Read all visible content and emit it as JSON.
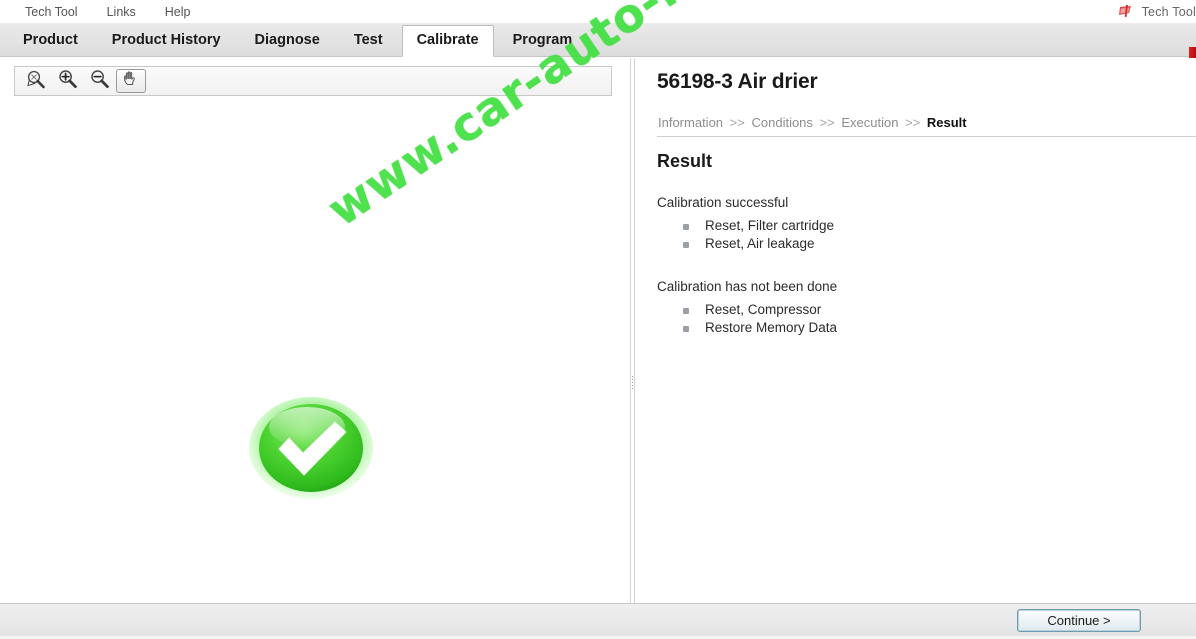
{
  "app": {
    "brand_name": "Tech Tool",
    "brand_logo_icon": "volvo-flag-logo-icon"
  },
  "menubar": {
    "items": [
      {
        "label": "Tech Tool",
        "name": "menu-tech-tool"
      },
      {
        "label": "Links",
        "name": "menu-links"
      },
      {
        "label": "Help",
        "name": "menu-help"
      }
    ]
  },
  "tabs": [
    {
      "label": "Product",
      "active": false
    },
    {
      "label": "Product History",
      "active": false
    },
    {
      "label": "Diagnose",
      "active": false
    },
    {
      "label": "Test",
      "active": false
    },
    {
      "label": "Calibrate",
      "active": true
    },
    {
      "label": "Program",
      "active": false
    }
  ],
  "viewer": {
    "toolbar": [
      {
        "icon": "zoom-to-fit-icon",
        "name": "zoom-to-fit-button",
        "selected": false
      },
      {
        "icon": "zoom-in-icon",
        "name": "zoom-in-button",
        "selected": false
      },
      {
        "icon": "zoom-out-icon",
        "name": "zoom-out-button",
        "selected": false
      },
      {
        "icon": "pan-hand-icon",
        "name": "pan-tool-button",
        "selected": true
      }
    ],
    "status_icon": "green-check-success-icon"
  },
  "content": {
    "title": "56198-3 Air drier",
    "breadcrumb": [
      {
        "label": "Information",
        "current": false
      },
      {
        "label": "Conditions",
        "current": false
      },
      {
        "label": "Execution",
        "current": false
      },
      {
        "label": "Result",
        "current": true
      }
    ],
    "breadcrumb_separator": ">>",
    "section_title": "Result",
    "blocks": [
      {
        "heading": "Calibration successful",
        "items": [
          "Reset, Filter cartridge",
          "Reset, Air leakage"
        ]
      },
      {
        "heading": "Calibration has not been done",
        "items": [
          "Reset, Compressor",
          "Restore Memory Data"
        ]
      }
    ]
  },
  "footer": {
    "continue_label": "Continue >"
  },
  "watermark": {
    "text": "www.car-auto-repair.com"
  },
  "colors": {
    "success_green": "#45cc2e",
    "watermark_green": "#3fe03f",
    "accent_blue": "#6f9bb0",
    "brand_red": "#e02020",
    "tabstrip_gray": "#e2e2e2"
  }
}
